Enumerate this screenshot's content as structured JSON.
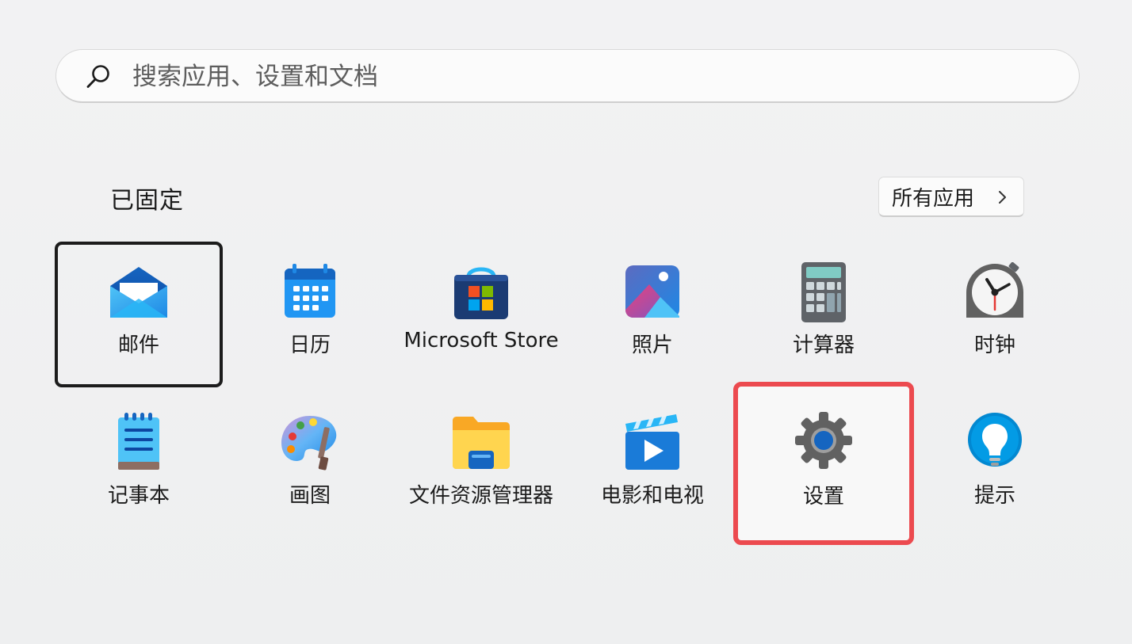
{
  "search": {
    "placeholder": "搜索应用、设置和文档",
    "value": ""
  },
  "pinned": {
    "title": "已固定",
    "all_apps_label": "所有应用"
  },
  "apps": [
    {
      "label": "邮件",
      "icon": "mail-icon",
      "state": "focused"
    },
    {
      "label": "日历",
      "icon": "calendar-icon",
      "state": "normal"
    },
    {
      "label": "Microsoft Store",
      "icon": "microsoft-store-icon",
      "state": "normal"
    },
    {
      "label": "照片",
      "icon": "photos-icon",
      "state": "normal"
    },
    {
      "label": "计算器",
      "icon": "calculator-icon",
      "state": "normal"
    },
    {
      "label": "时钟",
      "icon": "clock-icon",
      "state": "normal"
    },
    {
      "label": "记事本",
      "icon": "notepad-icon",
      "state": "normal"
    },
    {
      "label": "画图",
      "icon": "paint-icon",
      "state": "normal"
    },
    {
      "label": "文件资源管理器",
      "icon": "file-explorer-icon",
      "state": "normal"
    },
    {
      "label": "电影和电视",
      "icon": "movies-tv-icon",
      "state": "normal"
    },
    {
      "label": "设置",
      "icon": "settings-gear-icon",
      "state": "highlighted"
    },
    {
      "label": "提示",
      "icon": "tips-icon",
      "state": "normal"
    }
  ],
  "colors": {
    "highlight_border": "#ec4a4f",
    "focus_border": "#1c1c1c",
    "background": "#eff0f1"
  }
}
